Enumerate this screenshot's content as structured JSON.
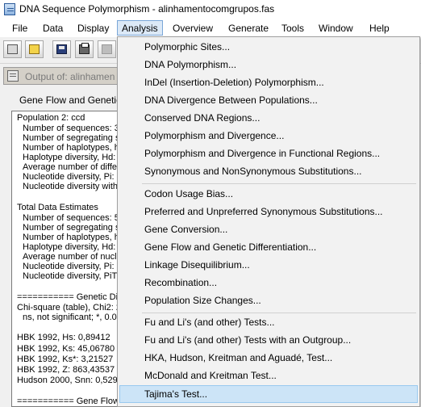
{
  "window": {
    "title": "DNA Sequence Polymorphism - alinhamentocomgrupos.fas"
  },
  "menubar": {
    "items": [
      {
        "label": "File"
      },
      {
        "label": "Data"
      },
      {
        "label": "Display"
      },
      {
        "label": "Analysis"
      },
      {
        "label": "Overview"
      },
      {
        "label": "Generate"
      },
      {
        "label": "Tools"
      },
      {
        "label": "Window"
      },
      {
        "label": "Help"
      }
    ]
  },
  "toolbar": {
    "icons": [
      "open-file-icon",
      "folder-icon",
      "save-icon",
      "print-icon",
      "disabled-tool-icon"
    ]
  },
  "output": {
    "title": "Output of: alinhamen",
    "heading": "Gene Flow and Genetic",
    "lines": [
      "Population 2: ccd",
      "Number of sequences: 3",
      "Number of segregating s",
      "Number of haplotypes, h",
      "Haplotype diversity, Hd:",
      "Average number of differ",
      "Nucleotide diversity, Pi: 0",
      "Nucleotide diversity with",
      "",
      "Total Data Estimates",
      "Number of sequences: 5",
      "Number of segregating s",
      "Number of haplotypes, h",
      "Haplotype diversity, Hd:",
      "Average number of nucle",
      "Nucleotide diversity, Pi:",
      "Nucleotide diversity, PiT",
      "",
      "=========== Genetic Dif",
      "Chi-square (table), Chi2: 2",
      "ns, not significant;  *, 0.0",
      "",
      "HBK 1992, Hs: 0,89412",
      "HBK 1992, Ks: 45,06780",
      "HBK 1992, Ks*: 3,21527",
      "HBK 1992, Z: 863,43537",
      "Hudson 2000, Snn: 0,529",
      "",
      "=========== Gene Flow"
    ]
  },
  "analysis_menu": {
    "groups": [
      [
        "Polymorphic Sites...",
        "DNA Polymorphism...",
        "InDel (Insertion-Deletion) Polymorphism...",
        "DNA Divergence Between Populations...",
        "Conserved DNA Regions...",
        "Polymorphism and Divergence...",
        "Polymorphism and Divergence in Functional Regions...",
        "Synonymous and NonSynonymous Substitutions..."
      ],
      [
        "Codon Usage Bias...",
        "Preferred and Unpreferred Synonymous Substitutions...",
        "Gene Conversion...",
        "Gene Flow and Genetic Differentiation...",
        "Linkage Disequilibrium...",
        "Recombination...",
        "Population Size Changes..."
      ],
      [
        "Fu and Li's (and other) Tests...",
        "Fu and Li's (and other) Tests with an Outgroup...",
        "HKA, Hudson, Kreitman and Aguadé, Test...",
        "McDonald and Kreitman Test...",
        "Tajima's Test..."
      ]
    ],
    "highlighted": "Tajima's Test..."
  },
  "colors": {
    "highlight_bg": "#cce4f7",
    "highlight_border": "#99c9ef",
    "menu_bg": "#f2f2f2"
  }
}
